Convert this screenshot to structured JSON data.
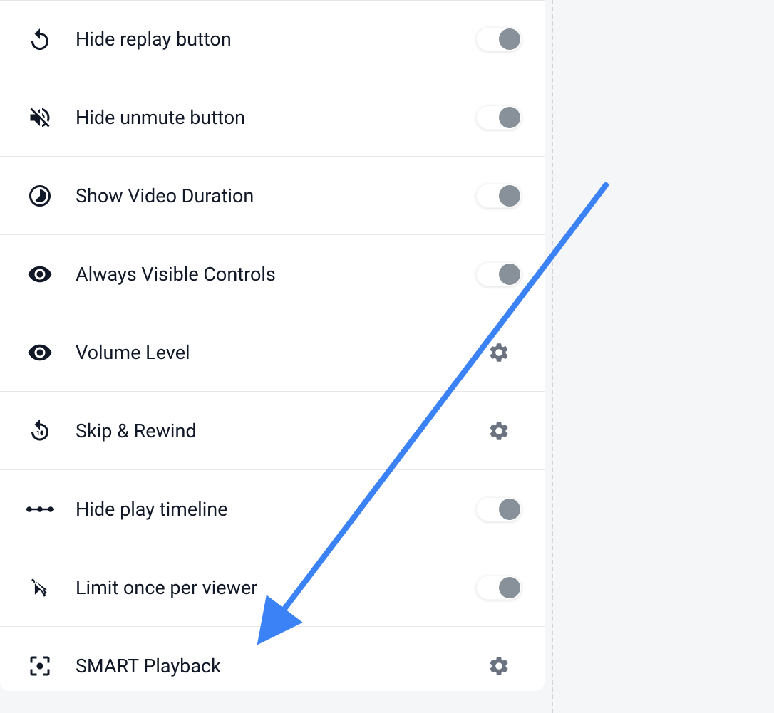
{
  "settings": [
    {
      "label": "Hide replay button",
      "control": "toggle",
      "on": false
    },
    {
      "label": "Hide unmute button",
      "control": "toggle",
      "on": false
    },
    {
      "label": "Show Video Duration",
      "control": "toggle",
      "on": false
    },
    {
      "label": "Always Visible Controls",
      "control": "toggle",
      "on": false
    },
    {
      "label": "Volume Level",
      "control": "gear"
    },
    {
      "label": "Skip & Rewind",
      "control": "gear"
    },
    {
      "label": "Hide play timeline",
      "control": "toggle",
      "on": false
    },
    {
      "label": "Limit once per viewer",
      "control": "toggle",
      "on": false
    },
    {
      "label": "SMART Playback",
      "control": "gear"
    }
  ],
  "arrow": {
    "color": "#3b82f6"
  }
}
